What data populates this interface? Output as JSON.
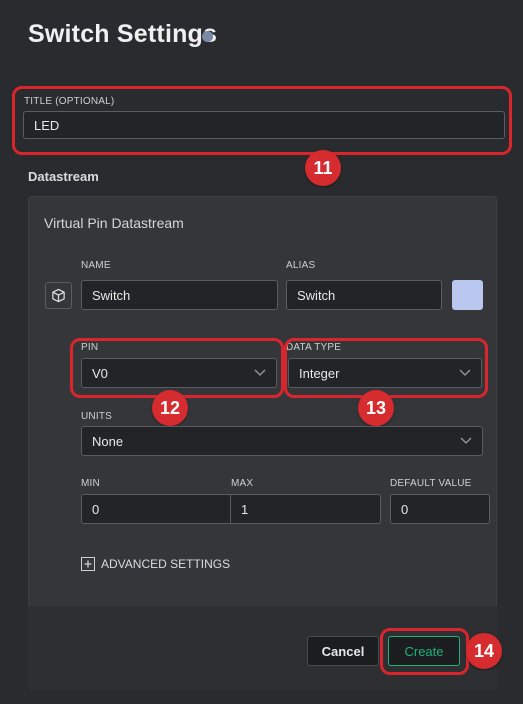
{
  "header": {
    "title": "Switch Settings"
  },
  "title_field": {
    "label": "TITLE (OPTIONAL)",
    "value": "LED"
  },
  "datastream": {
    "section_label": "Datastream",
    "card_title": "Virtual Pin Datastream",
    "name": {
      "label": "NAME",
      "value": "Switch"
    },
    "alias": {
      "label": "ALIAS",
      "value": "Switch"
    },
    "swatch_color": "#b9c6ee",
    "pin": {
      "label": "PIN",
      "value": "V0"
    },
    "data_type": {
      "label": "DATA TYPE",
      "value": "Integer"
    },
    "units": {
      "label": "UNITS",
      "value": "None"
    },
    "min": {
      "label": "MIN",
      "value": "0"
    },
    "max": {
      "label": "MAX",
      "value": "1"
    },
    "default_value": {
      "label": "DEFAULT VALUE",
      "value": "0"
    },
    "advanced": "ADVANCED SETTINGS"
  },
  "footer": {
    "cancel": "Cancel",
    "create": "Create"
  },
  "annotations": {
    "n11": "11",
    "n12": "12",
    "n13": "13",
    "n14": "14"
  },
  "colors": {
    "accent_green": "#1fb17a",
    "highlight_red": "#d9262c"
  }
}
